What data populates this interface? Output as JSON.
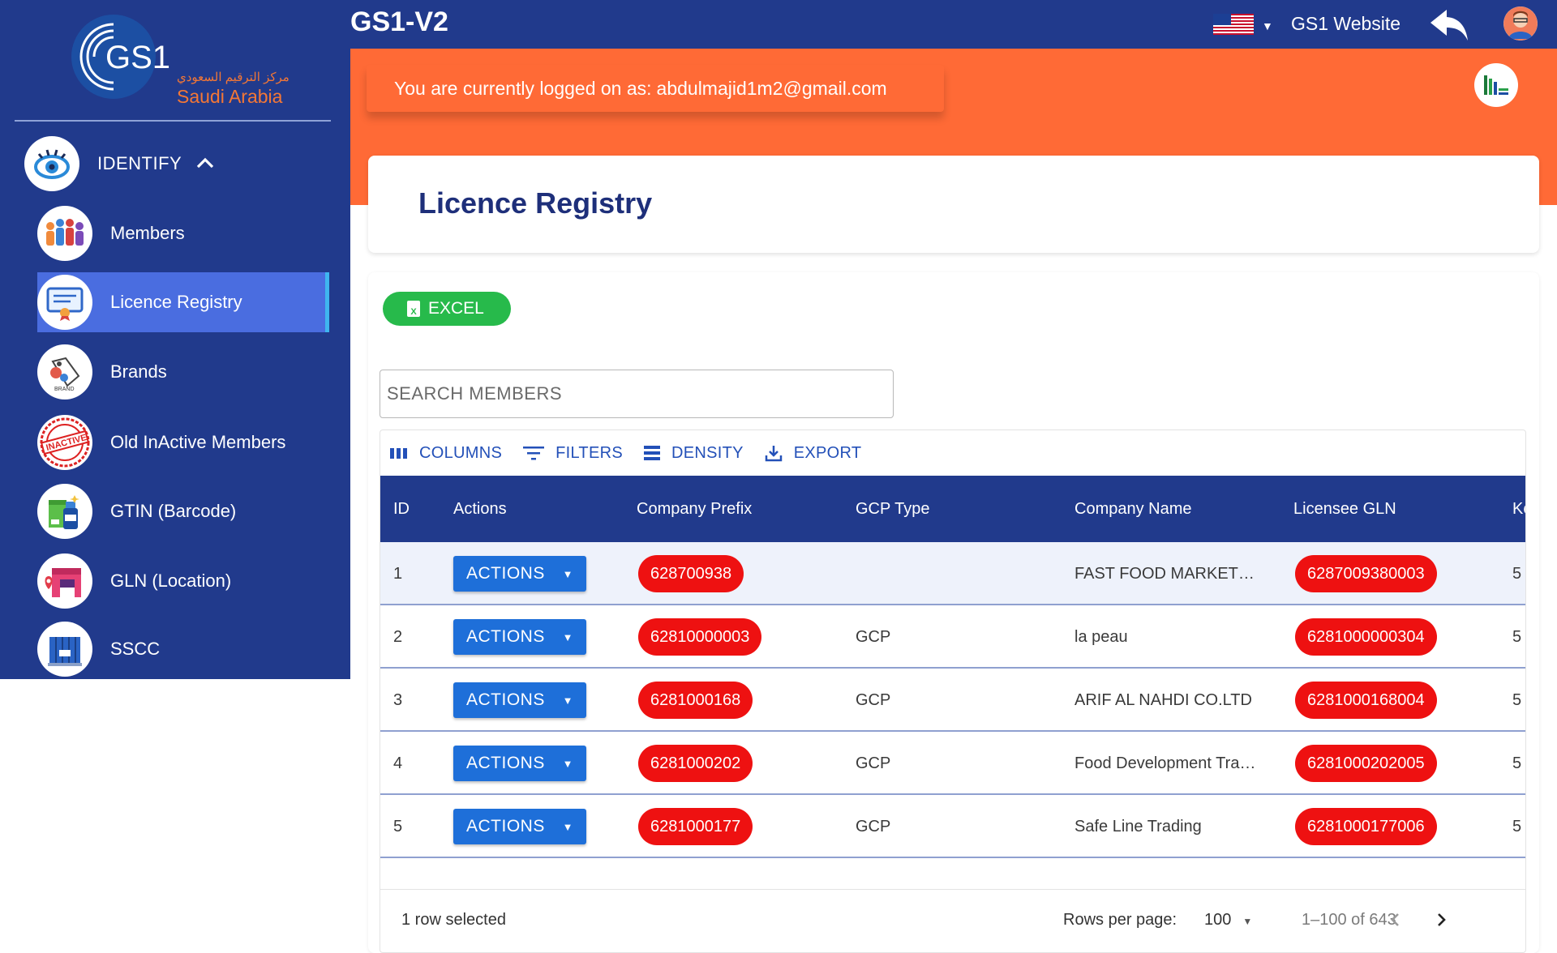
{
  "app": {
    "title": "GS1-V2"
  },
  "brand": {
    "logo_text": "GS1",
    "arabic_name": "مركز الترقيم السعودي",
    "country": "Saudi Arabia"
  },
  "sidebar": {
    "section": {
      "label": "IDENTIFY",
      "expanded": true
    },
    "items": [
      {
        "label": "Members",
        "icon": "members-icon",
        "active": false
      },
      {
        "label": "Licence Registry",
        "icon": "certificate-icon",
        "active": true
      },
      {
        "label": "Brands",
        "icon": "brand-tag-icon",
        "active": false
      },
      {
        "label": "Old InActive Members",
        "icon": "inactive-stamp-icon",
        "active": false
      },
      {
        "label": "GTIN (Barcode)",
        "icon": "gtin-box-icon",
        "active": false
      },
      {
        "label": "GLN (Location)",
        "icon": "location-store-icon",
        "active": false
      },
      {
        "label": "SSCC",
        "icon": "container-icon",
        "active": false
      }
    ]
  },
  "header": {
    "language": "en-US",
    "website_link": "GS1 Website"
  },
  "banner": {
    "prefix": "You are currently logged on as:",
    "email": "abdulmajid1m2@gmail.com"
  },
  "page": {
    "title": "Licence Registry"
  },
  "buttons": {
    "excel": "EXCEL"
  },
  "search": {
    "placeholder": "SEARCH MEMBERS",
    "value": ""
  },
  "toolbar": {
    "columns": "COLUMNS",
    "filters": "FILTERS",
    "density": "DENSITY",
    "export": "EXPORT"
  },
  "table": {
    "headers": [
      "ID",
      "Actions",
      "Company Prefix",
      "GCP Type",
      "Company Name",
      "Licensee GLN",
      "Ke"
    ],
    "rows": [
      {
        "id": "1",
        "action": "ACTIONS",
        "prefix": "628700938",
        "gcp_type": "",
        "company": "FAST FOOD MARKET…",
        "gln": "6287009380003",
        "extra": "5",
        "selected": true
      },
      {
        "id": "2",
        "action": "ACTIONS",
        "prefix": "62810000003",
        "gcp_type": "GCP",
        "company": "la peau",
        "gln": "6281000000304",
        "extra": "5",
        "selected": false
      },
      {
        "id": "3",
        "action": "ACTIONS",
        "prefix": "6281000168",
        "gcp_type": "GCP",
        "company": "ARIF AL NAHDI CO.LTD",
        "gln": "6281000168004",
        "extra": "5",
        "selected": false
      },
      {
        "id": "4",
        "action": "ACTIONS",
        "prefix": "6281000202",
        "gcp_type": "GCP",
        "company": "Food Development Tra…",
        "gln": "6281000202005",
        "extra": "5",
        "selected": false
      },
      {
        "id": "5",
        "action": "ACTIONS",
        "prefix": "6281000177",
        "gcp_type": "GCP",
        "company": "Safe Line Trading",
        "gln": "6281000177006",
        "extra": "5",
        "selected": false
      }
    ]
  },
  "footer": {
    "selection": "1 row selected",
    "rows_per_page_label": "Rows per page:",
    "rows_per_page": "100",
    "range": "1–100 of 643"
  },
  "colors": {
    "navy": "#213a8c",
    "orange": "#ff6a36",
    "green": "#27ba4b",
    "pill_red": "#ee1111",
    "action_blue": "#1e6fd9"
  }
}
